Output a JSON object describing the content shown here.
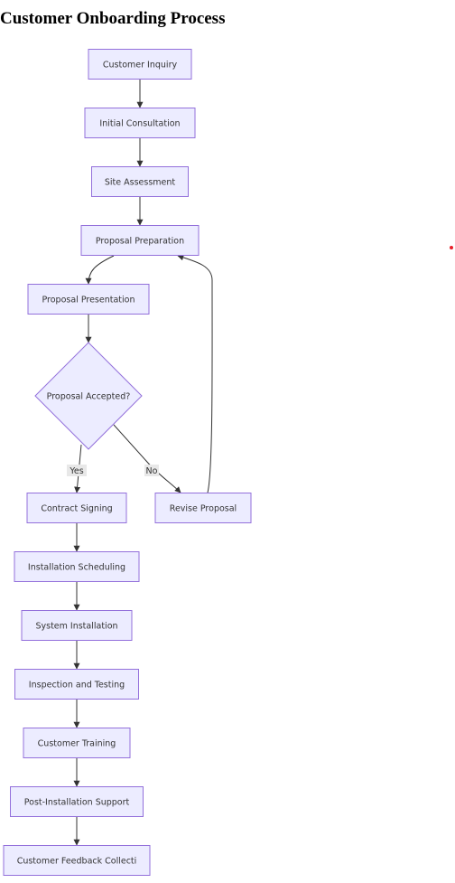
{
  "title": "Customer Onboarding Process",
  "colors": {
    "node_fill": "#ECECFF",
    "node_stroke": "#9370DB",
    "edge": "#333333",
    "edge_label_bg": "#e8e8e8",
    "marker_dot": "#e8202a"
  },
  "nodes": [
    {
      "id": "inquiry",
      "label": "Customer Inquiry",
      "shape": "rect"
    },
    {
      "id": "consult",
      "label": "Initial Consultation",
      "shape": "rect"
    },
    {
      "id": "site",
      "label": "Site Assessment",
      "shape": "rect"
    },
    {
      "id": "prep",
      "label": "Proposal Preparation",
      "shape": "rect"
    },
    {
      "id": "present",
      "label": "Proposal Presentation",
      "shape": "rect"
    },
    {
      "id": "accepted",
      "label": "Proposal Accepted?",
      "shape": "diamond"
    },
    {
      "id": "contract",
      "label": "Contract Signing",
      "shape": "rect"
    },
    {
      "id": "revise",
      "label": "Revise Proposal",
      "shape": "rect"
    },
    {
      "id": "schedule",
      "label": "Installation Scheduling",
      "shape": "rect"
    },
    {
      "id": "install",
      "label": "System Installation",
      "shape": "rect"
    },
    {
      "id": "inspect",
      "label": "Inspection and Testing",
      "shape": "rect"
    },
    {
      "id": "training",
      "label": "Customer Training",
      "shape": "rect"
    },
    {
      "id": "support",
      "label": "Post-Installation Support",
      "shape": "rect"
    },
    {
      "id": "feedback",
      "label": "Customer Feedback Collecti",
      "shape": "rect"
    }
  ],
  "edges": [
    {
      "from": "inquiry",
      "to": "consult",
      "label": ""
    },
    {
      "from": "consult",
      "to": "site",
      "label": ""
    },
    {
      "from": "site",
      "to": "prep",
      "label": ""
    },
    {
      "from": "prep",
      "to": "present",
      "label": ""
    },
    {
      "from": "present",
      "to": "accepted",
      "label": ""
    },
    {
      "from": "accepted",
      "to": "contract",
      "label": "Yes"
    },
    {
      "from": "accepted",
      "to": "revise",
      "label": "No"
    },
    {
      "from": "revise",
      "to": "prep",
      "label": ""
    },
    {
      "from": "contract",
      "to": "schedule",
      "label": ""
    },
    {
      "from": "schedule",
      "to": "install",
      "label": ""
    },
    {
      "from": "install",
      "to": "inspect",
      "label": ""
    },
    {
      "from": "inspect",
      "to": "training",
      "label": ""
    },
    {
      "from": "training",
      "to": "support",
      "label": ""
    },
    {
      "from": "support",
      "to": "feedback",
      "label": ""
    }
  ]
}
